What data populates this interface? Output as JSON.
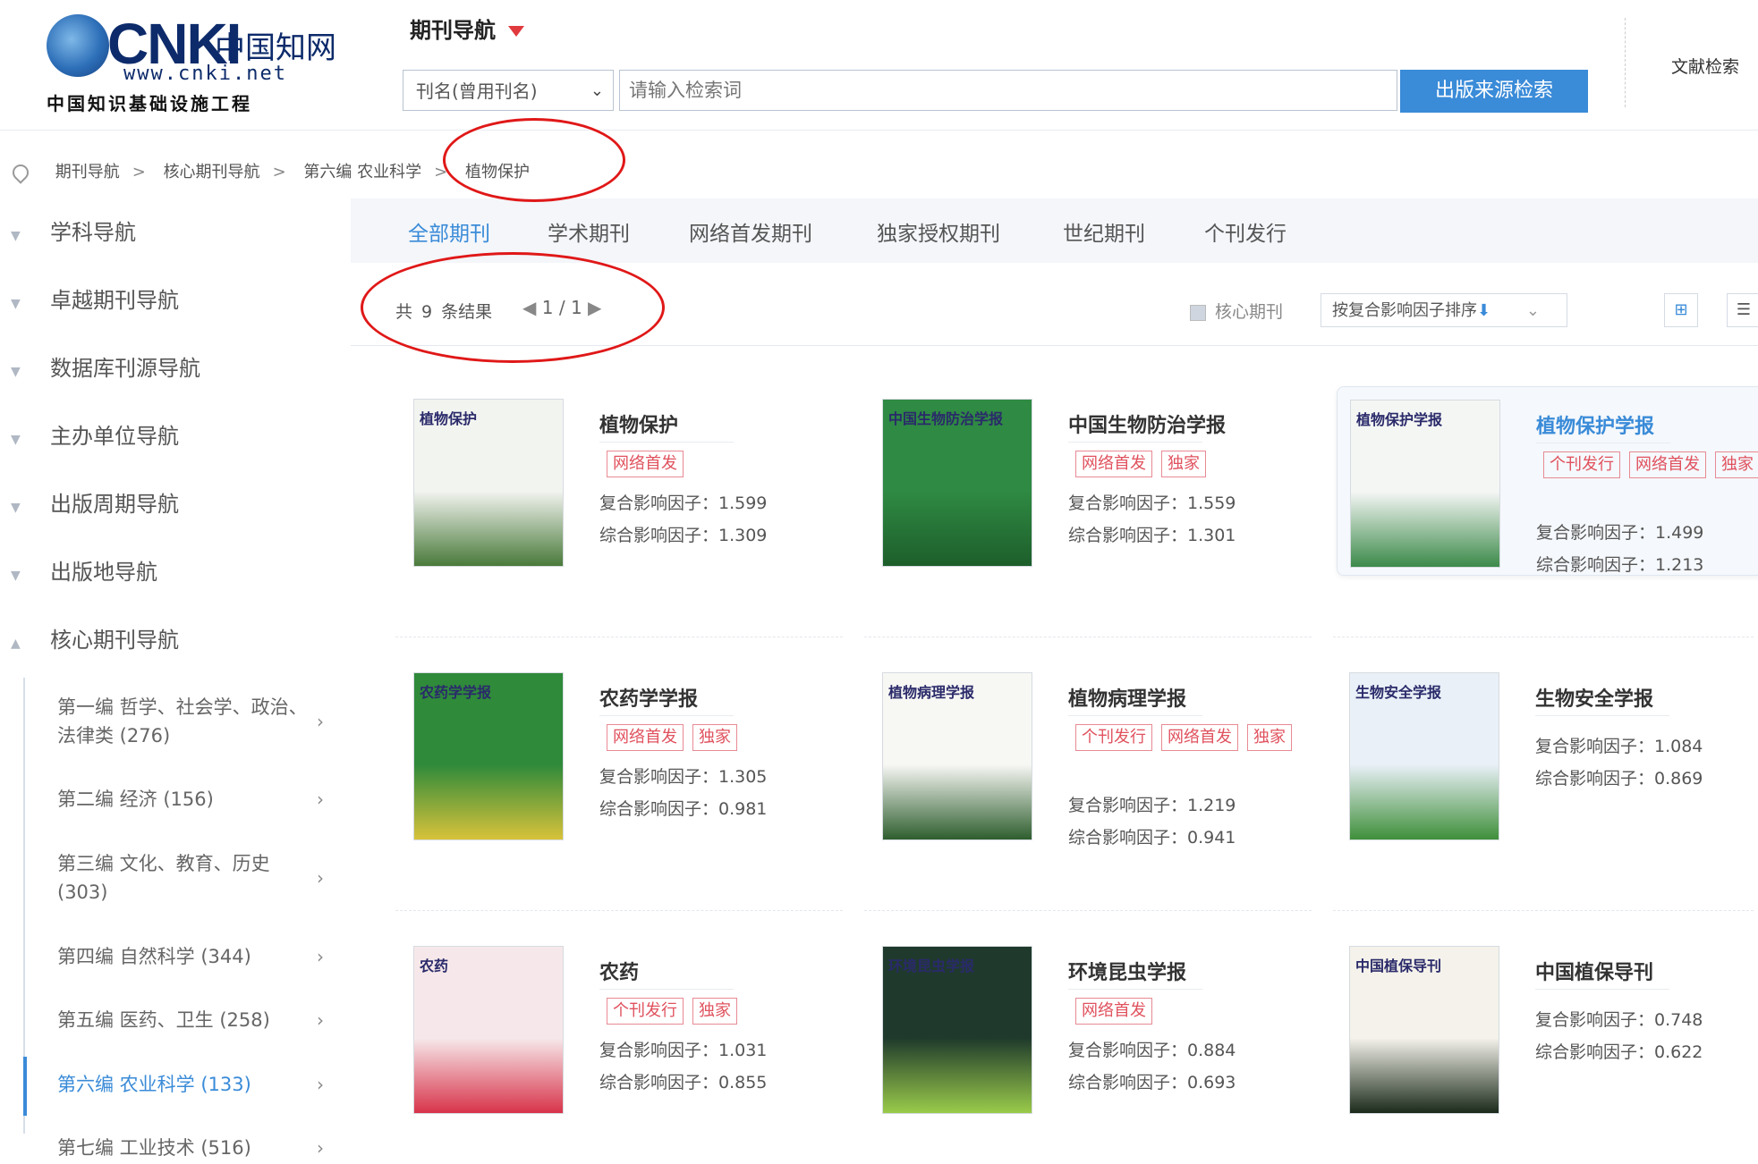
{
  "header": {
    "logo": {
      "brand": "CNKI",
      "cn_name": "中国知网",
      "url": "www.cnki.net",
      "slogan": "中国知识基础设施工程"
    },
    "nav_title": "期刊导航",
    "search": {
      "field": "刊名(曾用刊名)",
      "placeholder": "请输入检索词",
      "button": "出版来源检索"
    },
    "top_link": "文献检索"
  },
  "breadcrumb": [
    "期刊导航",
    "核心期刊导航",
    "第六编 农业科学",
    "植物保护"
  ],
  "sidebar": {
    "items": [
      "学科导航",
      "卓越期刊导航",
      "数据库刊源导航",
      "主办单位导航",
      "出版周期导航",
      "出版地导航",
      "核心期刊导航"
    ],
    "sub_items": [
      {
        "label": "第一编 哲学、社会学、政治、法律类 (276)",
        "active": false
      },
      {
        "label": "第二编 经济 (156)",
        "active": false
      },
      {
        "label": "第三编 文化、教育、历史 (303)",
        "active": false
      },
      {
        "label": "第四编 自然科学 (344)",
        "active": false
      },
      {
        "label": "第五编 医药、卫生 (258)",
        "active": false
      },
      {
        "label": "第六编 农业科学 (133)",
        "active": true
      },
      {
        "label": "第七编 工业技术 (516)",
        "active": false
      }
    ]
  },
  "tabs": [
    "全部期刊",
    "学术期刊",
    "网络首发期刊",
    "独家授权期刊",
    "世纪期刊",
    "个刊发行"
  ],
  "results": {
    "prefix": "共",
    "count": "9",
    "suffix": "条结果",
    "page": "1",
    "sep": "/",
    "total_pages": "1",
    "prev": "◀",
    "next": "▶",
    "core_label": "核心期刊",
    "core_checked": true,
    "sort": "按复合影响因子排序",
    "sort_arrow": "⬇",
    "view_grid_icon": "grid-icon",
    "view_list_icon": "list-icon"
  },
  "metric_labels": {
    "composite": "复合影响因子：",
    "comprehensive": "综合影响因子："
  },
  "journals": [
    {
      "name": "植物保护",
      "tags": [
        "网络首发"
      ],
      "composite": "1.599",
      "comprehensive": "1.309",
      "cover_title": "植物保护",
      "cover_color": "#f2f4f0",
      "cover_accent": "#4a7a3a"
    },
    {
      "name": "中国生物防治学报",
      "tags": [
        "网络首发",
        "独家"
      ],
      "composite": "1.559",
      "comprehensive": "1.301",
      "cover_title": "中国生物防治学报",
      "cover_color": "#2f8a43",
      "cover_accent": "#1d5e2b"
    },
    {
      "name": "植物保护学报",
      "tags": [
        "个刊发行",
        "网络首发",
        "独家"
      ],
      "composite": "1.499",
      "comprehensive": "1.213",
      "cover_title": "植物保护学报",
      "cover_color": "#f4f6f4",
      "cover_accent": "#3c8a4a",
      "highlight": true
    },
    {
      "name": "农药学学报",
      "tags": [
        "网络首发",
        "独家"
      ],
      "composite": "1.305",
      "comprehensive": "0.981",
      "cover_title": "农药学学报",
      "cover_color": "#2f8a3a",
      "cover_accent": "#d8c23a"
    },
    {
      "name": "植物病理学报",
      "tags": [
        "个刊发行",
        "网络首发",
        "独家"
      ],
      "composite": "1.219",
      "comprehensive": "0.941",
      "cover_title": "植物病理学报",
      "cover_color": "#f7f7f4",
      "cover_accent": "#2e5e2e"
    },
    {
      "name": "生物安全学报",
      "tags": [],
      "composite": "1.084",
      "comprehensive": "0.869",
      "cover_title": "生物安全学报",
      "cover_color": "#e9f0f7",
      "cover_accent": "#3f8f3a"
    },
    {
      "name": "农药",
      "tags": [
        "个刊发行",
        "独家"
      ],
      "composite": "1.031",
      "comprehensive": "0.855",
      "cover_title": "农药",
      "cover_color": "#f6e8ea",
      "cover_accent": "#d8334a"
    },
    {
      "name": "环境昆虫学报",
      "tags": [
        "网络首发"
      ],
      "composite": "0.884",
      "comprehensive": "0.693",
      "cover_title": "环境昆虫学报",
      "cover_color": "#1f3a2c",
      "cover_accent": "#9acb4a"
    },
    {
      "name": "中国植保导刊",
      "tags": [],
      "composite": "0.748",
      "comprehensive": "0.622",
      "cover_title": "中国植保导刊",
      "cover_color": "#f4f2ea",
      "cover_accent": "#1a2a1a"
    }
  ],
  "annotation_color": "#e01818"
}
